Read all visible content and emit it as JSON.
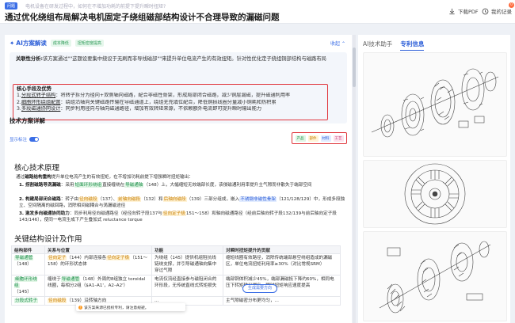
{
  "header": {
    "badge": "问题",
    "question": "电机设备在研发过程中，如何在不增加功耗的前提下提升瞬时扭矩?",
    "title": "通过优化绕组布局解决电机固定子绕组磁部结构设计不合理导致的漏磁问题",
    "download_label": "下载PDF",
    "history_label": "我的记录",
    "notif_count": "0"
  },
  "ai": {
    "title": "AI方案解读",
    "tags": [
      "成本降低",
      "扭矩密度提高"
    ],
    "collapse_label": "收起",
    "analysis_label": "关联性分析:",
    "analysis_text": "该方案通过\"\"这题设要集中绕设于无刷而非导线磁部\"\"来提升单位电流产生的有效扭矩。针对性优化定子绕组铜部结构与磁路布局",
    "advantages_title": "核心手段及优势",
    "advantages": [
      {
        "num": "1.",
        "name": "分段式转子结构",
        "text": "：将转子拆分为径向+双侧轴向磁路，配合非磁性骨架，形成局部闭合磁路，减少铜层漏磁，提升磁通利用率"
      },
      {
        "num": "2.",
        "name": "细胞环形绕组配置",
        "text": "：绕组沿轴向关键磁路传输在导磁通道上，绕组无充填位配合，降低铜损线圈分量减小铜耗和热积累"
      },
      {
        "num": "3.",
        "name": "多段磁通协同设计",
        "text": "：同步利用径向与轴向磁通路径，增加有效转矩来源，不依赖额外电流即可提升瞬时输出能力"
      }
    ]
  },
  "tech": {
    "heading": "技术方案详解",
    "show_label": "显示标注",
    "legend": [
      {
        "label": "产品",
        "bg": "#dff5e4",
        "fg": "#1d8f4a"
      },
      {
        "label": "部件",
        "bg": "#fff3d6",
        "fg": "#c77d00"
      },
      {
        "label": "材料",
        "bg": "#e1ebff",
        "fg": "#2d5fd8"
      },
      {
        "label": "工艺",
        "bg": "#fde1ec",
        "fg": "#c23872"
      }
    ],
    "principle_title": "核心技术原理",
    "intro_a": "通过",
    "intro_b": "磁路结构重构",
    "intro_c": "提升单位电流产生的有效扭矩，在不增加功耗前提下增强瞬时扭矩输出：",
    "p1_a": "1. 拐割磁路导涡漏磁",
    "p1_b": "：采用",
    "p1_c": "短面环形绕组",
    "p1_d": "直接缠绕在",
    "p1_e": "导磁通轴",
    "p1_f": "（148）上，大幅缩短无效端部长度，该侵磁通利用率提升主气隙而非散失于端部空间",
    "p2_a": "2. 构建局部闭合磁路",
    "p2_b": "：转子由",
    "p2_c": "径向磁段",
    "p2_d": "（137）、",
    "p2_e": "前轴向磁段",
    "p2_f": "（132）和",
    "p2_g": "后轴向磁段",
    "p2_h": "（139）三部分组成，嵌入",
    "p2_i": "不锈钢非磁性骨架",
    "p2_j": "（121/128/129）中，形成多段独立、空间隔离的磁回路，消除相间磁耦合与涡漏磁途径",
    "p3_a": "3. 激发多向磁通协同助力",
    "p3_b": "：同步利用径向磁通路径（经径向转子段137与",
    "p3_c": "径向定子极",
    "p3_d": "151～158）和轴向磁通路径（经前后轴向转子段132/139与前后轴向定子段143/146），使同一电流生成下产生叠加式 reluctance torque",
    "structure_title": "关键结构设计及作用",
    "table_headers": [
      "结构部件",
      "关系与位置",
      "功能",
      "对瞬时扭矩提升的贡献"
    ],
    "rows": [
      {
        "part": "导磁通管",
        "part_num": "（148）",
        "rel_a": "径向定子",
        "rel_b": "（144）内部连接各",
        "rel_c": "径向定子极",
        "rel_d": "（151～158）的环形状态体",
        "func": "为绕组（145）提供机组阻抗线链绕支撑，并引导磁通轴向集中穿过气隙",
        "contrib": "缩短线圈有效路径，消除传统端部悬空绕组造成的漏磁区，单位电流扭矩利用率≥30%（对比常规SRM）"
      },
      {
        "part": "细胞环形绕组",
        "part_num": "（145）",
        "rel_a": "缠绕于",
        "rel_b": "导磁通管",
        "rel_c": "（148）外周的8组独立 toroidal 线圈，每相分2组（$A1–A1'，A2–A2'）",
        "rel_d": "",
        "func": "电流仅流经直接参与磁阻闭合的环形段，无传统直线式转矩损失",
        "contrib": "端部铜体积减少45%，端部漏磁抵下降约60%，相同电压下转矩输出提升，瞬时扭矩响应速度提高"
      },
      {
        "part": "分段式转子",
        "part_num": "",
        "rel_a": "径向磁段",
        "rel_b": "（139）沿转轴方向",
        "rel_c": "",
        "rel_d": "",
        "func": "...",
        "contrib": "主气隙磁密分布更均匀，..."
      }
    ]
  },
  "toast": {
    "icon": "!",
    "text": "该方案来源已授权专利，请注意规避。"
  },
  "generate_label": "生成需要方向",
  "right": {
    "tabs": [
      "AI技术助手",
      "专利信息"
    ],
    "active_tab": 1
  }
}
